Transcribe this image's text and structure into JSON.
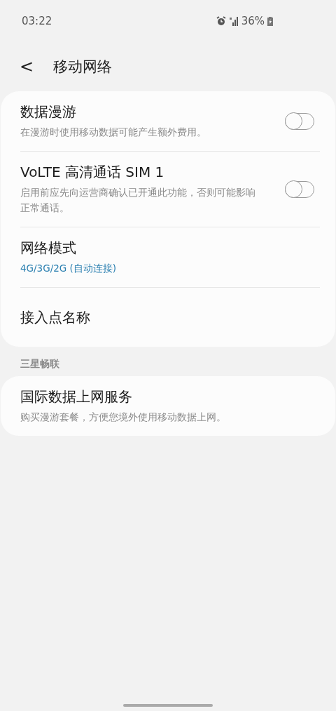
{
  "status_bar": {
    "time": "03:22",
    "battery": "36%"
  },
  "header": {
    "back": "<",
    "title": "移动网络"
  },
  "groups": [
    {
      "items": [
        {
          "kind": "switch",
          "title": "数据漫游",
          "summary": {
            "kind": "hint",
            "text": "在漫游时使用移动数据可能产生额外费用。"
          },
          "on": false
        },
        {
          "kind": "switch",
          "title": "VoLTE 高清通话 SIM 1",
          "summary": {
            "kind": "hint",
            "text": "启用前应先向运营商确认已开通此功能，否则可能影响正常通话。"
          },
          "on": false
        },
        {
          "kind": "link",
          "title": "网络模式",
          "summary": {
            "kind": "value",
            "text": "4G/3G/2G (自动连接)"
          }
        },
        {
          "kind": "link",
          "title": "接入点名称"
        }
      ]
    },
    {
      "heading": "三星畅联",
      "items": [
        {
          "kind": "link",
          "title": "国际数据上网服务",
          "summary": {
            "kind": "hint",
            "text": "购买漫游套餐，方便您境外使用移动数据上网。"
          }
        }
      ]
    }
  ]
}
